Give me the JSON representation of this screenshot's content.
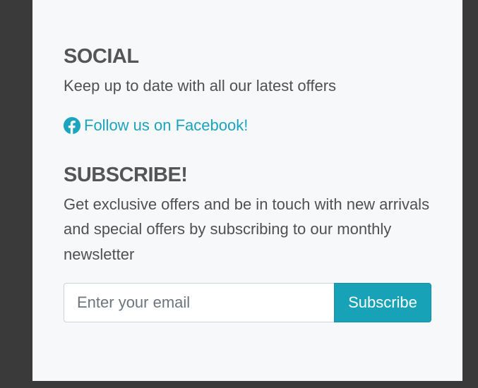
{
  "social": {
    "title": "SOCIAL",
    "description": "Keep up to date with all our latest offers",
    "facebook_link_label": "Follow us on Facebook!",
    "facebook_icon": "facebook-icon"
  },
  "subscribe": {
    "title": "SUBSCRIBE!",
    "description": "Get exclusive offers and be in touch with new arrivals and special offers by subscribing to our monthly newsletter",
    "email_placeholder": "Enter your email",
    "email_value": "",
    "button_label": "Subscribe"
  },
  "colors": {
    "accent": "#17a2b8",
    "link": "#1aa4bd",
    "heading": "#555555",
    "panel_bg": "#f7f8fa",
    "page_bg": "#3a3a3a"
  }
}
